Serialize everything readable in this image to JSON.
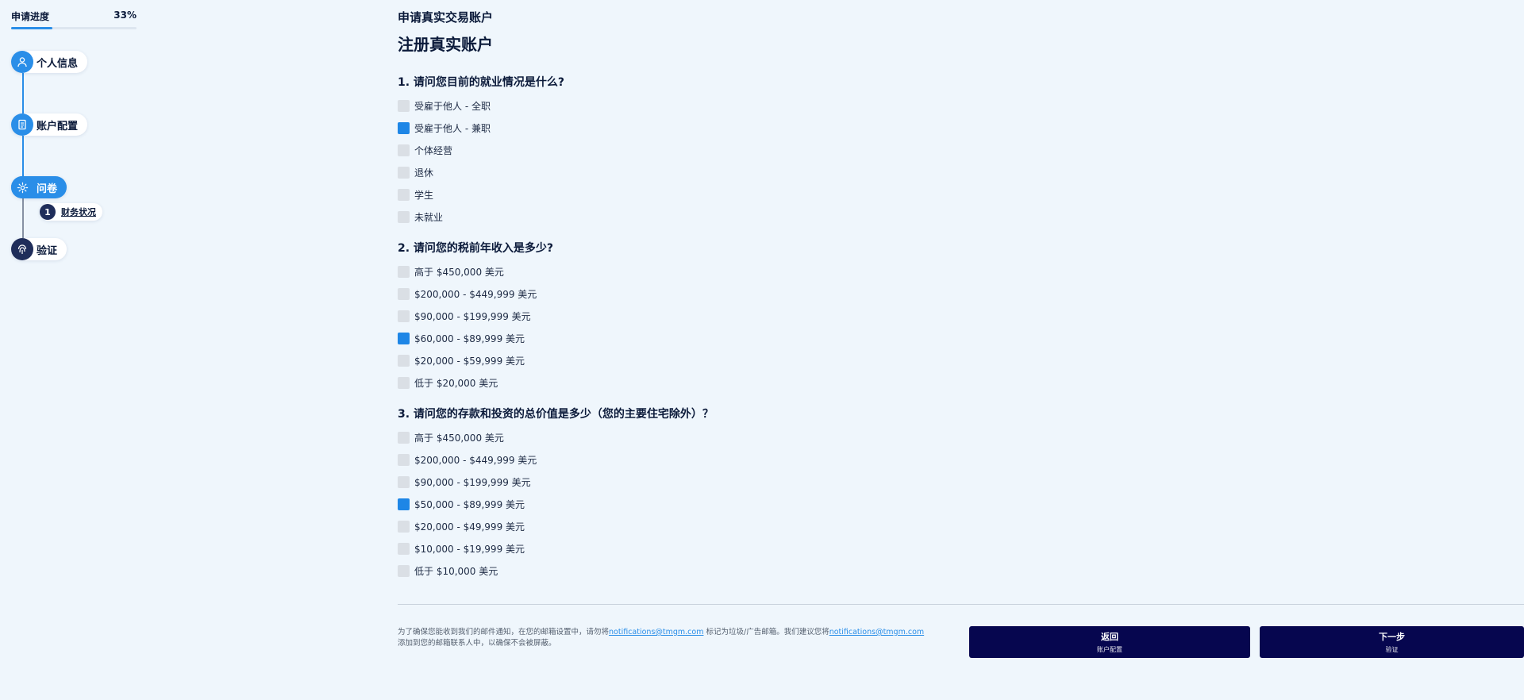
{
  "sidebar": {
    "progress_label": "申请进度",
    "progress_percent_text": "33%",
    "progress_fraction": 0.33,
    "steps": [
      {
        "label": "个人信息",
        "icon": "user-icon"
      },
      {
        "label": "账户配置",
        "icon": "document-icon"
      },
      {
        "label": "问卷",
        "icon": "gear-icon"
      },
      {
        "label": "验证",
        "icon": "fingerprint-icon"
      }
    ],
    "substep": {
      "number": "1",
      "label": "财务状况"
    }
  },
  "header": {
    "subtitle": "申请真实交易账户",
    "title": "注册真实账户"
  },
  "questions": [
    {
      "title": "1. 请问您目前的就业情况是什么?",
      "options": [
        {
          "label": "受雇于他人 - 全职",
          "checked": false
        },
        {
          "label": "受雇于他人 - 兼职",
          "checked": true
        },
        {
          "label": "个体经营",
          "checked": false
        },
        {
          "label": "退休",
          "checked": false
        },
        {
          "label": "学生",
          "checked": false
        },
        {
          "label": "未就业",
          "checked": false
        }
      ]
    },
    {
      "title": "2. 请问您的税前年收入是多少?",
      "options": [
        {
          "label": "高于 $450,000 美元",
          "checked": false
        },
        {
          "label": "$200,000 - $449,999 美元",
          "checked": false
        },
        {
          "label": "$90,000 - $199,999 美元",
          "checked": false
        },
        {
          "label": "$60,000 - $89,999 美元",
          "checked": true
        },
        {
          "label": "$20,000 - $59,999 美元",
          "checked": false
        },
        {
          "label": "低于 $20,000 美元",
          "checked": false
        }
      ]
    },
    {
      "title": "3. 请问您的存款和投资的总价值是多少（您的主要住宅除外）？",
      "options": [
        {
          "label": "高于 $450,000 美元",
          "checked": false
        },
        {
          "label": "$200,000 - $449,999 美元",
          "checked": false
        },
        {
          "label": "$90,000 - $199,999 美元",
          "checked": false
        },
        {
          "label": "$50,000 - $89,999 美元",
          "checked": true
        },
        {
          "label": "$20,000 - $49,999 美元",
          "checked": false
        },
        {
          "label": "$10,000 - $19,999 美元",
          "checked": false
        },
        {
          "label": "低于 $10,000 美元",
          "checked": false
        }
      ]
    }
  ],
  "footer": {
    "notice_part1": "为了确保您能收到我们的邮件通知，在您的邮箱设置中，请勿将",
    "notice_email1": "notifications@tmgm.com",
    "notice_part2": "标记为垃圾/广告邮箱。我们建议您将",
    "notice_email2": "notifications@tmgm.com",
    "notice_part3": "添加到您的邮箱联系人中，以确保不会被屏蔽。",
    "back_button": {
      "label": "返回",
      "sub": "账户配置"
    },
    "next_button": {
      "label": "下一步",
      "sub": "验证"
    }
  },
  "colors": {
    "accent": "#2a8ee8",
    "checked": "#1e86e6",
    "button": "#06064f",
    "background": "#eff6fc"
  }
}
